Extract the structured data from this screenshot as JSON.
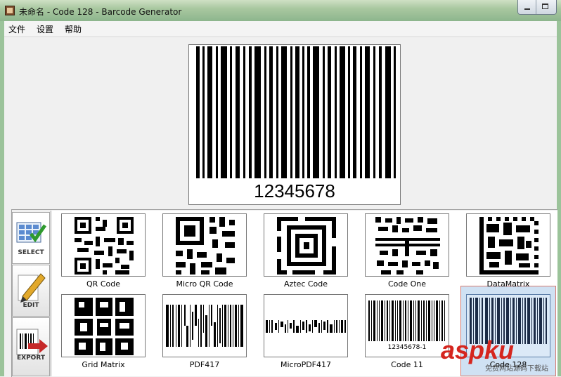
{
  "window": {
    "title": "未命名 - Code 128 - Barcode Generator"
  },
  "menu": {
    "items": [
      "文件",
      "设置",
      "帮助"
    ]
  },
  "preview": {
    "value": "12345678"
  },
  "sidetabs": [
    {
      "label": "SELECT"
    },
    {
      "label": "EDIT"
    },
    {
      "label": "EXPORT"
    }
  ],
  "gallery": {
    "items": [
      {
        "label": "QR Code"
      },
      {
        "label": "Micro QR Code"
      },
      {
        "label": "Aztec Code"
      },
      {
        "label": "Code One"
      },
      {
        "label": "DataMatrix"
      },
      {
        "label": "Grid Matrix"
      },
      {
        "label": "PDF417"
      },
      {
        "label": "MicroPDF417"
      },
      {
        "label": "Code 11"
      },
      {
        "label": "Code 128"
      }
    ],
    "code11_caption": "12345678-1"
  },
  "watermark": {
    "text": "aspku",
    "sub": "免费网站源码下载站"
  }
}
